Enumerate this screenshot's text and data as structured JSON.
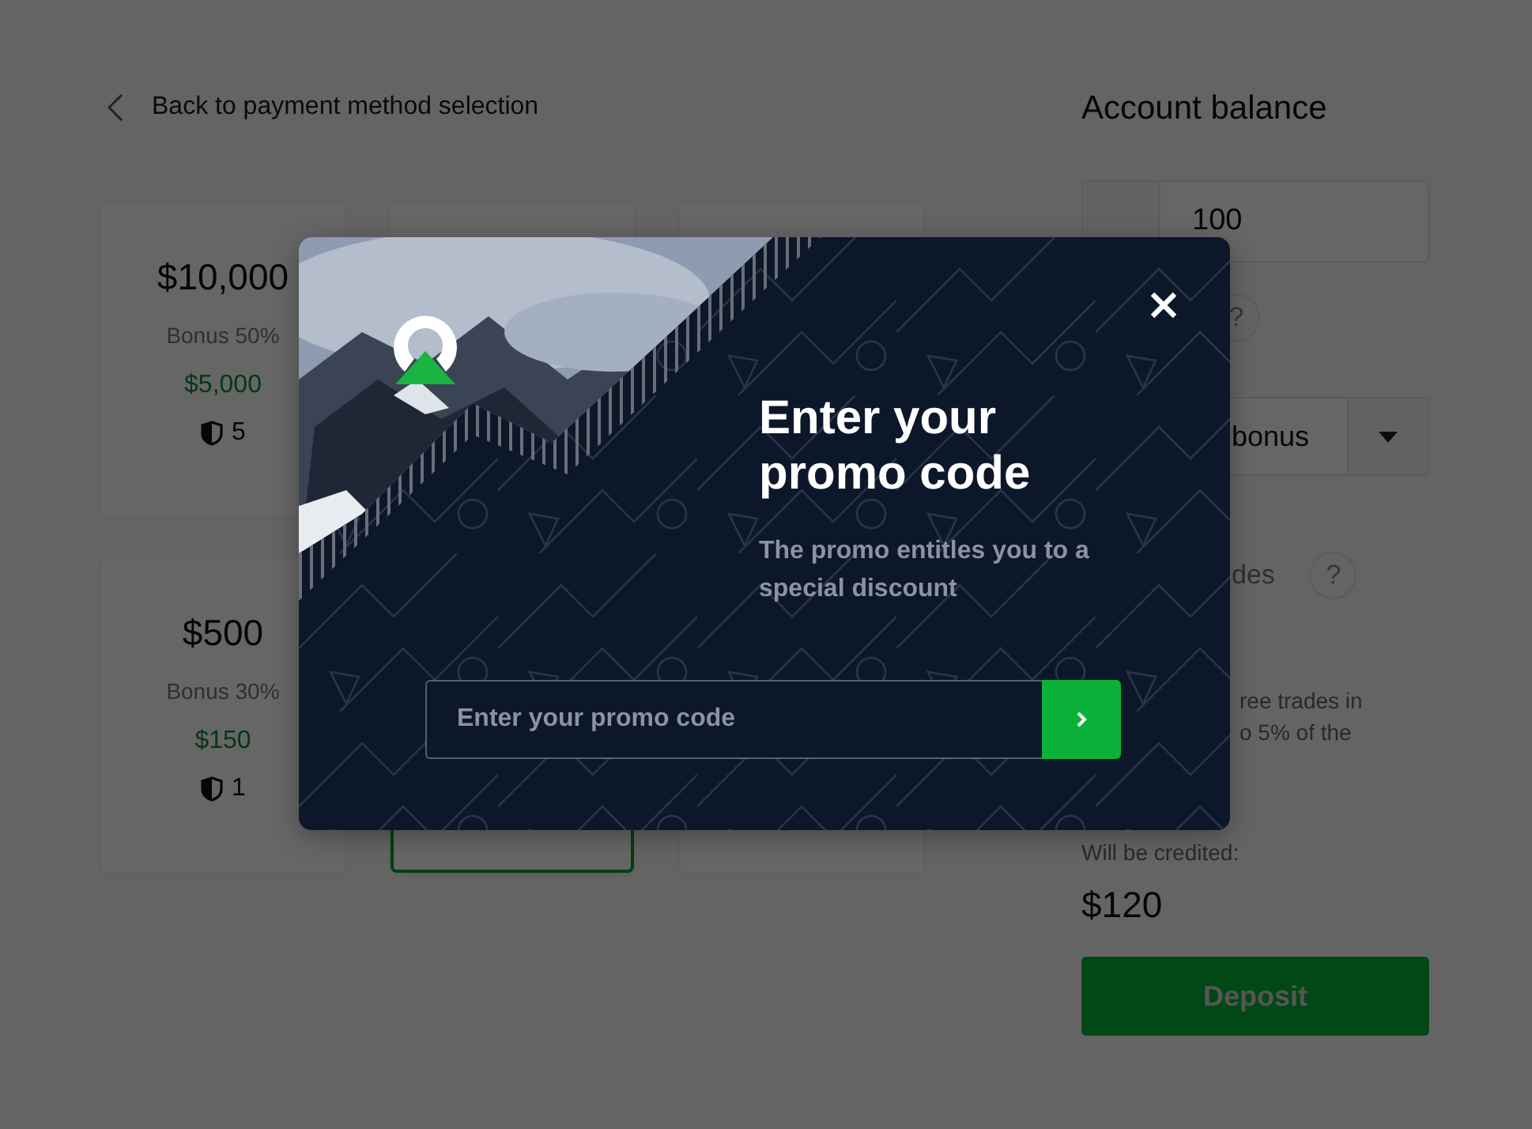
{
  "back_link": {
    "label": "Back to payment method selection"
  },
  "packages": [
    {
      "amount": "$10,000",
      "bonus": "Bonus 50%",
      "bonus_amount": "$5,000",
      "trades": "5",
      "selected": false
    },
    {
      "selected": false
    },
    {
      "selected": false
    },
    {
      "amount": "$500",
      "bonus": "Bonus 30%",
      "bonus_amount": "$150",
      "trades": "1",
      "selected": false
    },
    {
      "selected": true
    },
    {
      "selected": false
    }
  ],
  "balance": {
    "title": "Account balance",
    "amount_value": "100",
    "bonus_help": "?",
    "bonus_select": "bonus",
    "free_trades_label": "des",
    "free_trades_help": "?",
    "note_lines": [
      "ree trades in",
      "o 5% of the"
    ],
    "credited_label": "Will be credited:",
    "credited_value": "$120",
    "deposit": "Deposit"
  },
  "modal": {
    "title": "Enter your promo code",
    "subtitle": "The promo entitles you to a special discount",
    "input": {
      "placeholder": "Enter your promo code"
    }
  }
}
